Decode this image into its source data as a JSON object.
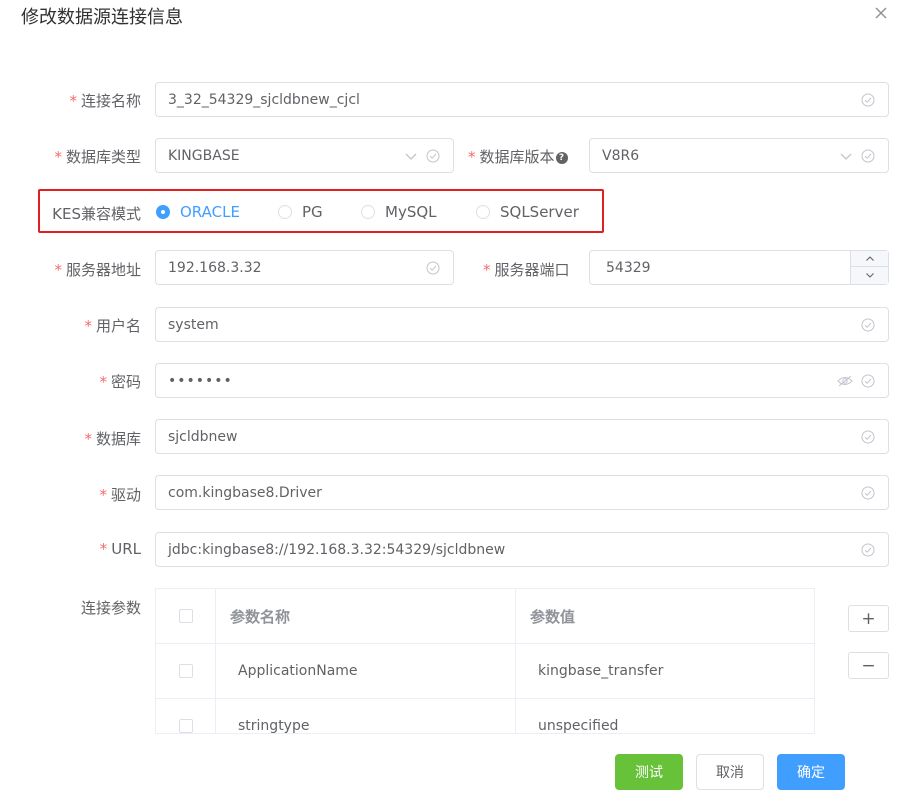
{
  "dialog": {
    "title": "修改数据源连接信息"
  },
  "form": {
    "connection_name": {
      "label": "连接名称",
      "value": "3_32_54329_sjcldbnew_cjcl"
    },
    "db_type": {
      "label": "数据库类型",
      "value": "KINGBASE"
    },
    "db_version": {
      "label": "数据库版本",
      "value": "V8R6"
    },
    "kes_mode": {
      "label": "KES兼容模式",
      "options": [
        "ORACLE",
        "PG",
        "MySQL",
        "SQLServer"
      ],
      "selected": "ORACLE"
    },
    "server_address": {
      "label": "服务器地址",
      "value": "192.168.3.32"
    },
    "server_port": {
      "label": "服务器端口",
      "value": "54329"
    },
    "username": {
      "label": "用户名",
      "value": "system"
    },
    "password": {
      "label": "密码",
      "value": "•••••••"
    },
    "database": {
      "label": "数据库",
      "value": "sjcldbnew"
    },
    "driver": {
      "label": "驱动",
      "value": "com.kingbase8.Driver"
    },
    "url": {
      "label": "URL",
      "value": "jdbc:kingbase8://192.168.3.32:54329/sjcldbnew"
    },
    "params": {
      "label": "连接参数",
      "columns": [
        "参数名称",
        "参数值"
      ],
      "rows": [
        {
          "name": "ApplicationName",
          "value": "kingbase_transfer"
        },
        {
          "name": "stringtype",
          "value": "unspecified"
        }
      ]
    }
  },
  "buttons": {
    "add": "+",
    "remove": "−",
    "test": "测试",
    "cancel": "取消",
    "ok": "确定"
  },
  "colors": {
    "primary": "#409eff",
    "success": "#67c23a",
    "required": "#f56c6c",
    "highlight_border": "#e02020"
  }
}
